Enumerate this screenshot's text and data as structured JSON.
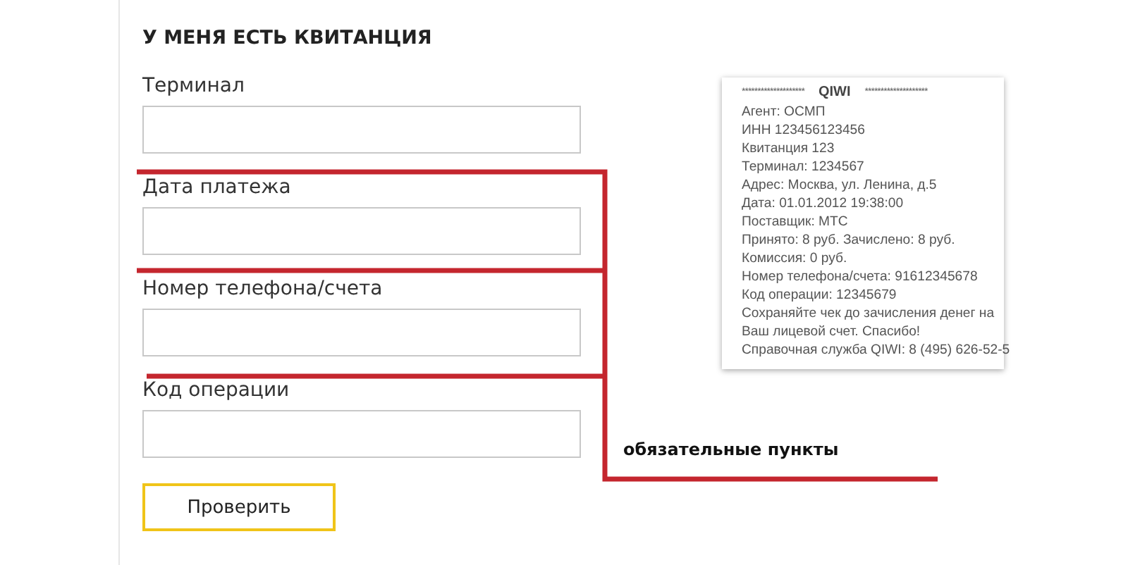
{
  "form": {
    "title": "У МЕНЯ ЕСТЬ КВИТАНЦИЯ",
    "fields": [
      {
        "label": "Терминал"
      },
      {
        "label": "Дата платежа"
      },
      {
        "label": "Номер телефона/счета"
      },
      {
        "label": "Код операции"
      }
    ],
    "submit": "Проверить"
  },
  "annotation": "обязательные пункты",
  "receipt": {
    "stars_left": "********************",
    "brand": "QIWI",
    "stars_right": "********************",
    "lines": [
      "Агент: ОСМП",
      "ИНН 123456123456",
      "Квитанция 123",
      "Терминал: 1234567",
      "Адрес: Москва, ул. Ленина, д.5",
      "Дата: 01.01.2012 19:38:00",
      "Поставщик: МТС",
      "Принято: 8 руб.  Зачислено: 8 руб.",
      "Комиссия: 0 руб.",
      "Номер телефона/счета: 91612345678",
      "Код операции: 12345679",
      "Сохраняйте чек до зачисления денег на",
      "Ваш лицевой счет. Спасибо!",
      "Справочная служба QIWI: 8 (495) 626-52-5"
    ]
  }
}
